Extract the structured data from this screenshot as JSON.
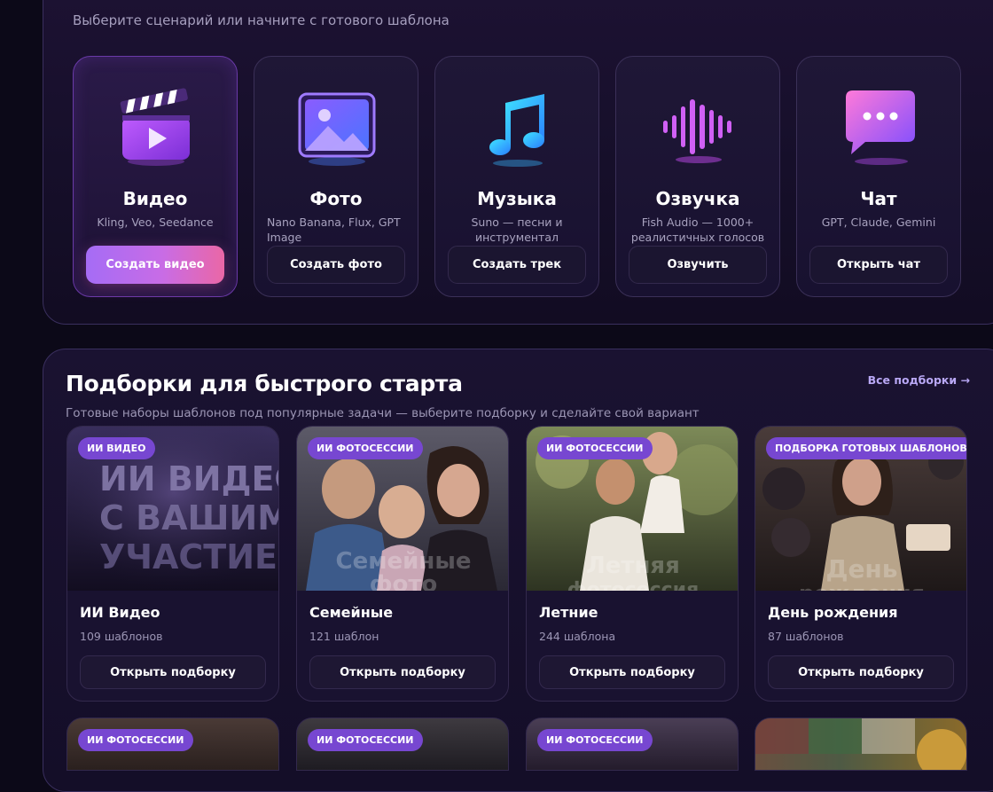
{
  "header": {
    "subtitle": "Выберите сценарий или начните с готового шаблона"
  },
  "categories": [
    {
      "title": "Видео",
      "desc": "Kling, Veo, Seedance",
      "button": "Создать видео",
      "icon": "film-clapper-icon"
    },
    {
      "title": "Фото",
      "desc": "Nano Banana, Flux, GPT Image",
      "button": "Создать фото",
      "icon": "image-icon"
    },
    {
      "title": "Музыка",
      "desc": "Suno — песни и инструментал",
      "button": "Создать трек",
      "icon": "music-note-icon"
    },
    {
      "title": "Озвучка",
      "desc": "Fish Audio — 1000+ реалистичных голосов",
      "button": "Озвучить",
      "icon": "sound-wave-icon"
    },
    {
      "title": "Чат",
      "desc": "GPT, Claude, Gemini",
      "button": "Открыть чат",
      "icon": "chat-bubble-icon"
    }
  ],
  "collections": {
    "title": "Подборки для быстрого старта",
    "subtitle": "Готовые наборы шаблонов под популярные задачи — выберите подборку и сделайте свой вариант",
    "all_link": "Все подборки →",
    "items": [
      {
        "badge": "ИИ ВИДЕО",
        "name": "ИИ Видео",
        "count": "109 шаблонов",
        "button": "Открыть подборку",
        "cover_text": "ИИ ВИДЕО С ВАШИМ УЧАСТИЕМ"
      },
      {
        "badge": "ИИ ФОТОСЕССИИ",
        "name": "Семейные",
        "count": "121 шаблон",
        "button": "Открыть подборку",
        "cover_text": "Семейные фото"
      },
      {
        "badge": "ИИ ФОТОСЕССИИ",
        "name": "Летние",
        "count": "244 шаблона",
        "button": "Открыть подборку",
        "cover_text": "Летняя фотосессия"
      },
      {
        "badge": "ПОДБОРКА ГОТОВЫХ ШАБЛОНОВ",
        "name": "День рождения",
        "count": "87 шаблонов",
        "button": "Открыть подборку",
        "cover_text": "День рождения"
      }
    ],
    "next_row_badges": [
      "ИИ ФОТОСЕССИИ",
      "ИИ ФОТОСЕССИИ",
      "ИИ ФОТОСЕССИИ"
    ]
  },
  "colors": {
    "background": "#0c0918",
    "accent_purple": "#7747d1",
    "primary_gradient_start": "#a56cf5",
    "primary_gradient_end": "#ea67a6",
    "link": "#b9a8f5"
  }
}
